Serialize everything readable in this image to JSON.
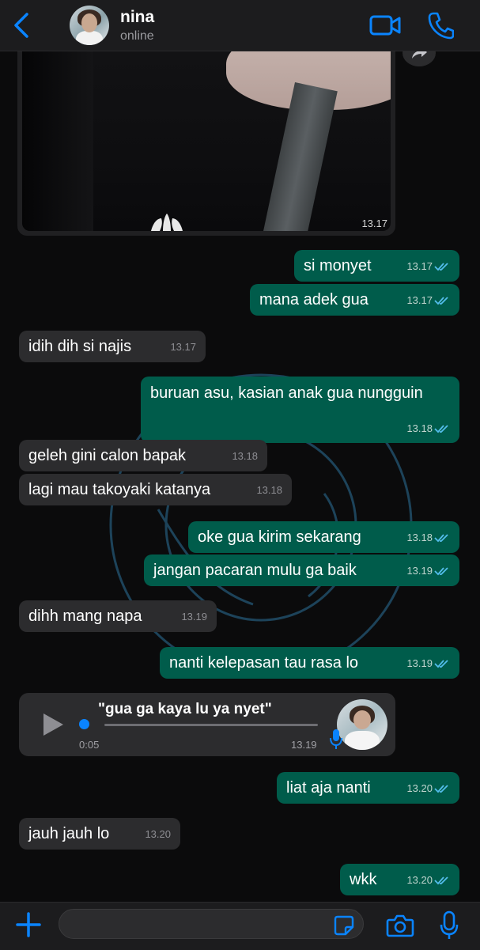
{
  "header": {
    "contact_name": "nina",
    "status": "online",
    "icons": [
      "back-chevron-icon",
      "video-call-icon",
      "phone-call-icon"
    ]
  },
  "photo_message": {
    "time": "13.17"
  },
  "messages": [
    {
      "dir": "out",
      "text": "si monyet",
      "time": "13.17",
      "read": true
    },
    {
      "dir": "out",
      "text": "mana adek gua",
      "time": "13.17",
      "read": true
    },
    {
      "dir": "in",
      "text": "idih dih si najis",
      "time": "13.17"
    },
    {
      "dir": "out",
      "text": "buruan asu, kasian anak gua nungguin",
      "time": "13.18",
      "read": true
    },
    {
      "dir": "in",
      "text": "geleh gini calon bapak",
      "time": "13.18"
    },
    {
      "dir": "in",
      "text": "lagi mau takoyaki katanya",
      "time": "13.18"
    },
    {
      "dir": "out",
      "text": "oke gua kirim sekarang",
      "time": "13.18",
      "read": true
    },
    {
      "dir": "out",
      "text": "jangan pacaran mulu ga baik",
      "time": "13.19",
      "read": true
    },
    {
      "dir": "in",
      "text": "dihh mang napa",
      "time": "13.19"
    },
    {
      "dir": "out",
      "text": "nanti kelepasan tau rasa lo",
      "time": "13.19",
      "read": true
    },
    {
      "dir": "out",
      "text": "liat aja nanti",
      "time": "13.20",
      "read": true
    },
    {
      "dir": "in",
      "text": "jauh jauh lo",
      "time": "13.20"
    },
    {
      "dir": "out",
      "text": "wkk",
      "time": "13.20",
      "read": true
    }
  ],
  "voice_note": {
    "caption": "\"gua ga kaya lu ya nyet\"",
    "duration": "0:05",
    "time": "13.19",
    "progress": 0
  },
  "composer": {
    "placeholder": "",
    "icons": [
      "plus-icon",
      "sticker-icon",
      "camera-icon",
      "microphone-icon"
    ]
  },
  "colors": {
    "outgoing_bubble": "#005c4b",
    "incoming_bubble": "#2c2c2e",
    "accent": "#0a84ff",
    "read_ticks": "#53bdeb"
  }
}
